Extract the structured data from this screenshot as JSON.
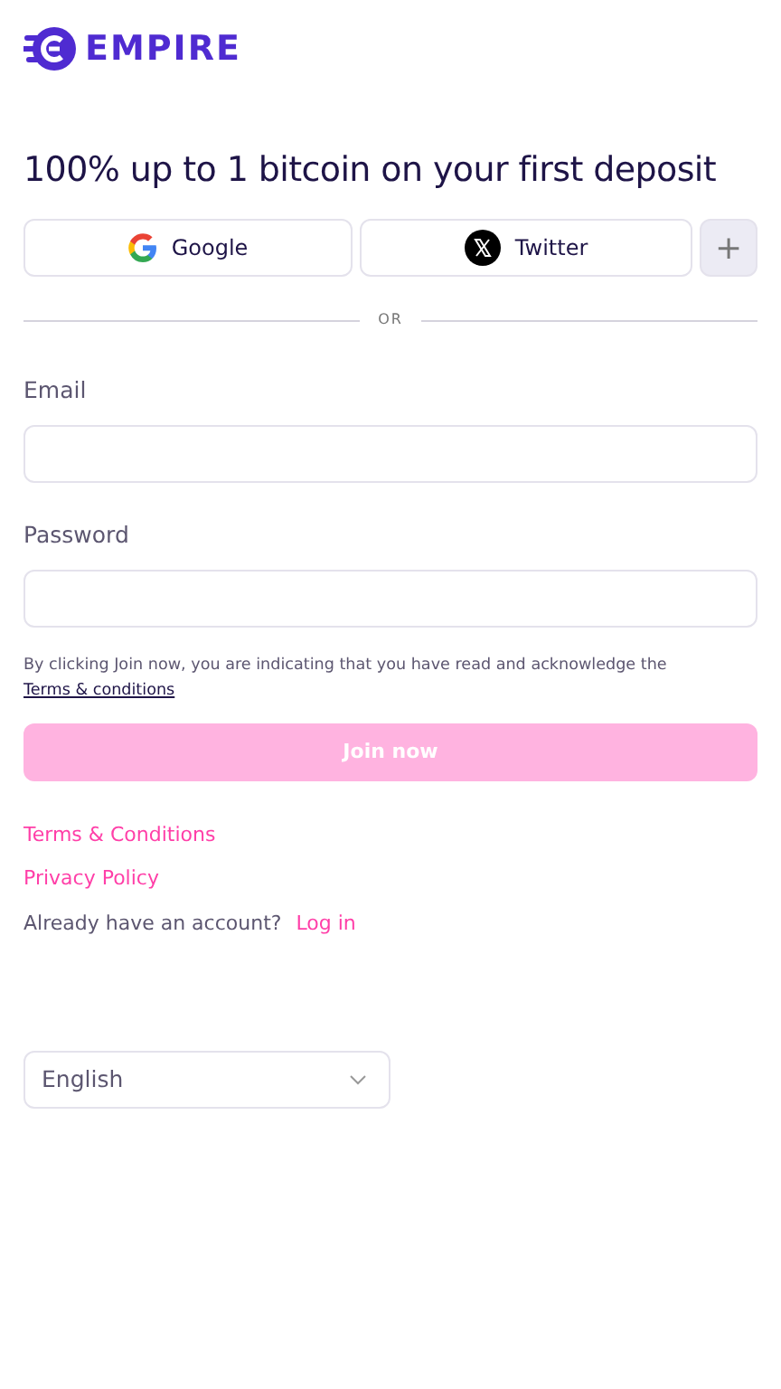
{
  "logo": {
    "text": "EMPIRE"
  },
  "headline": "100% up to 1 bitcoin on your first deposit",
  "social_buttons": [
    {
      "kind": "google",
      "label": "Google"
    },
    {
      "kind": "twitter",
      "label": "Twitter"
    },
    {
      "kind": "more",
      "label": "+"
    }
  ],
  "divider": "OR",
  "fields": [
    {
      "label": "Email"
    },
    {
      "label": "Password"
    }
  ],
  "consent": {
    "text": "By clicking Join now, you are indicating that you have read and acknowledge the",
    "link": "Terms & conditions"
  },
  "join_button": {
    "label": "Join now",
    "disabled": true
  },
  "links": [
    "Terms & Conditions",
    "Privacy Policy"
  ],
  "login_prompt": {
    "text": "Already have an account?",
    "link": "Log in"
  },
  "language": "English"
}
